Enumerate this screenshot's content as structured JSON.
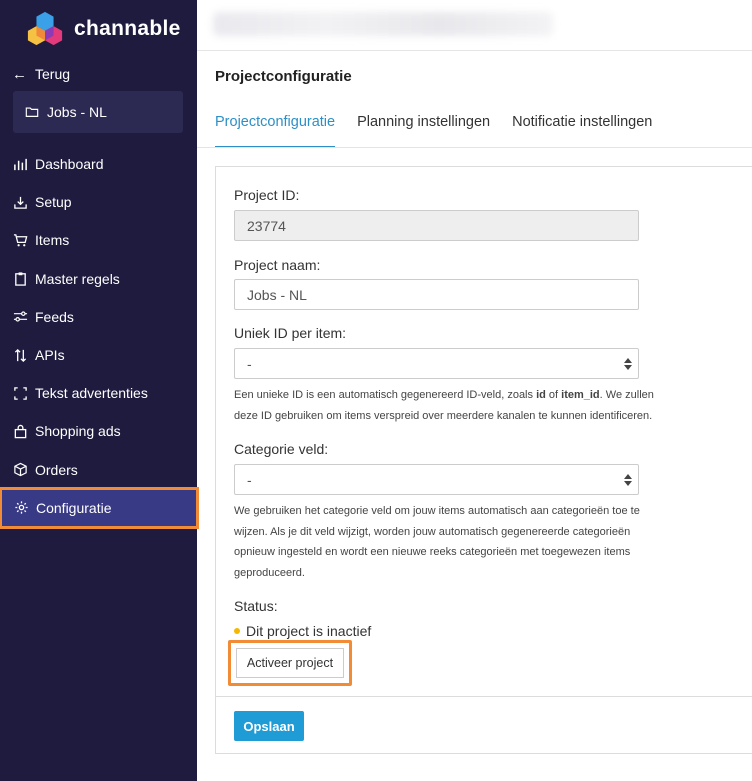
{
  "brand": {
    "name": "channable"
  },
  "sidebar": {
    "back_label": "Terug",
    "project_name": "Jobs - NL",
    "items": [
      {
        "label": "Dashboard",
        "icon": "bar-chart-icon"
      },
      {
        "label": "Setup",
        "icon": "download-tray-icon"
      },
      {
        "label": "Items",
        "icon": "cart-icon"
      },
      {
        "label": "Master regels",
        "icon": "clipboard-icon"
      },
      {
        "label": "Feeds",
        "icon": "sliders-icon"
      },
      {
        "label": "APIs",
        "icon": "up-down-arrows-icon"
      },
      {
        "label": "Tekst advertenties",
        "icon": "brackets-icon"
      },
      {
        "label": "Shopping ads",
        "icon": "shopping-bag-icon"
      },
      {
        "label": "Orders",
        "icon": "box-icon"
      },
      {
        "label": "Configuratie",
        "icon": "gear-icon",
        "active": true
      }
    ]
  },
  "page": {
    "title": "Projectconfiguratie",
    "tabs": [
      {
        "label": "Projectconfiguratie",
        "active": true
      },
      {
        "label": "Planning instellingen"
      },
      {
        "label": "Notificatie instellingen"
      }
    ]
  },
  "form": {
    "project_id_label": "Project ID:",
    "project_id_value": "23774",
    "project_name_label": "Project naam:",
    "project_name_value": "Jobs - NL",
    "unique_id_label": "Uniek ID per item:",
    "unique_id_value": "-",
    "unique_id_help_1": "Een unieke ID is een automatisch gegenereerd ID-veld, zoals ",
    "unique_id_help_id": "id",
    "unique_id_help_of": " of ",
    "unique_id_help_itemid": "item_id",
    "unique_id_help_2": ". We zullen deze ID gebruiken om items verspreid over meerdere kanalen te kunnen identificeren.",
    "category_label": "Categorie veld:",
    "category_value": "-",
    "category_help": "We gebruiken het categorie veld om jouw items automatisch aan categorieën toe te wijzen. Als je dit veld wijzigt, worden jouw automatisch gegenereerde categorieën opnieuw ingesteld en wordt een nieuwe reeks categorieën met toegewezen items geproduceerd.",
    "status_label": "Status:",
    "status_text": "Dit project is inactief",
    "activate_label": "Activeer project",
    "save_label": "Opslaan"
  },
  "colors": {
    "sidebar_bg": "#1e1b3e",
    "active_item_bg": "#393a85",
    "highlight": "#f28b36",
    "accent": "#2d8fc6",
    "save_button": "#1f9bd6",
    "status_dot": "#f5b800"
  }
}
